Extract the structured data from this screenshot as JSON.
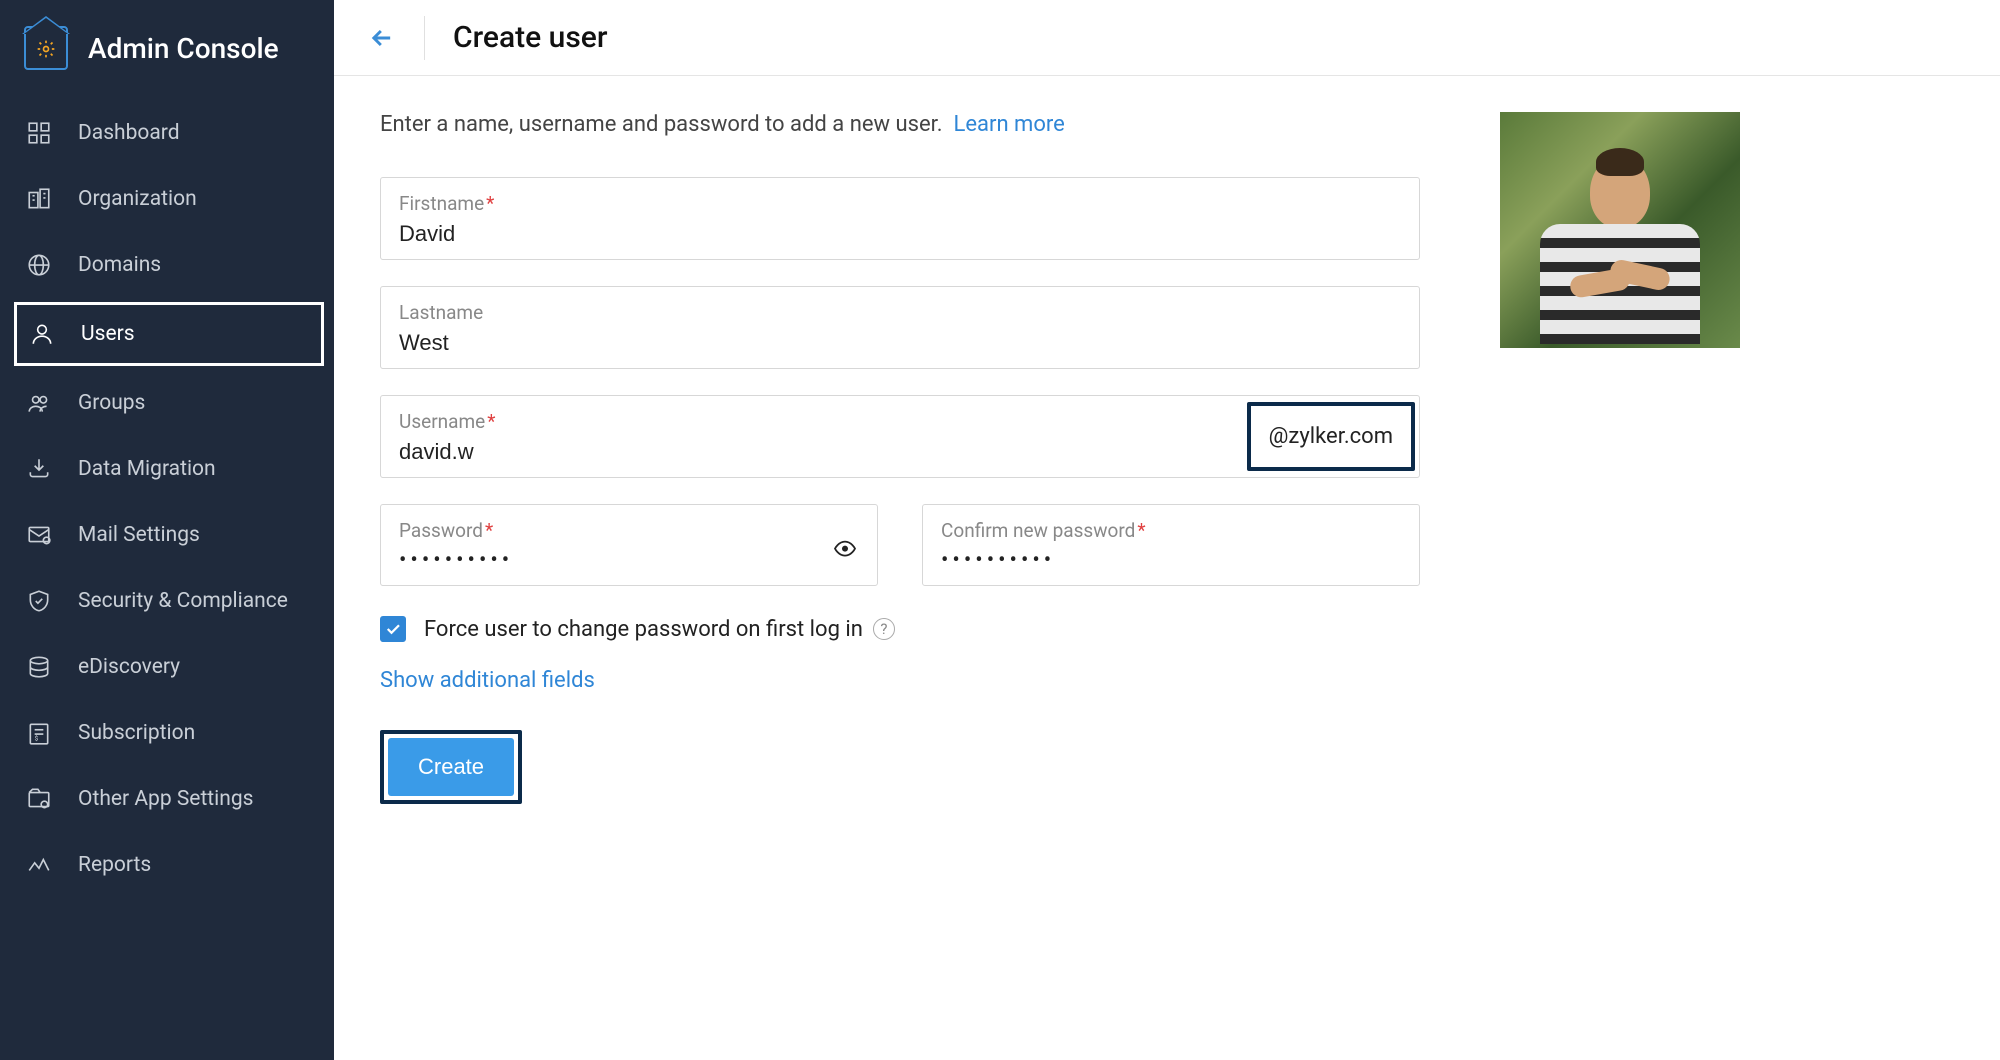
{
  "sidebar": {
    "title": "Admin Console",
    "items": [
      {
        "label": "Dashboard",
        "icon": "dashboard"
      },
      {
        "label": "Organization",
        "icon": "organization"
      },
      {
        "label": "Domains",
        "icon": "domains"
      },
      {
        "label": "Users",
        "icon": "users",
        "active": true
      },
      {
        "label": "Groups",
        "icon": "groups"
      },
      {
        "label": "Data Migration",
        "icon": "data-migration"
      },
      {
        "label": "Mail Settings",
        "icon": "mail-settings"
      },
      {
        "label": "Security & Compliance",
        "icon": "security"
      },
      {
        "label": "eDiscovery",
        "icon": "ediscovery"
      },
      {
        "label": "Subscription",
        "icon": "subscription"
      },
      {
        "label": "Other App Settings",
        "icon": "other-apps"
      },
      {
        "label": "Reports",
        "icon": "reports"
      }
    ]
  },
  "page": {
    "title": "Create user",
    "intro_text": "Enter a name, username and password to add a new user.",
    "learn_more": "Learn more"
  },
  "form": {
    "firstname": {
      "label": "Firstname",
      "value": "David",
      "required": true
    },
    "lastname": {
      "label": "Lastname",
      "value": "West",
      "required": false
    },
    "username": {
      "label": "Username",
      "value": "david.w",
      "required": true,
      "domain": "@zylker.com"
    },
    "password": {
      "label": "Password",
      "value": "••••••••••",
      "required": true
    },
    "confirm_password": {
      "label": "Confirm new password",
      "value": "••••••••••",
      "required": true
    },
    "force_change": {
      "label": "Force user to change password on first log in",
      "checked": true
    },
    "show_additional": "Show additional fields",
    "create_button": "Create"
  }
}
